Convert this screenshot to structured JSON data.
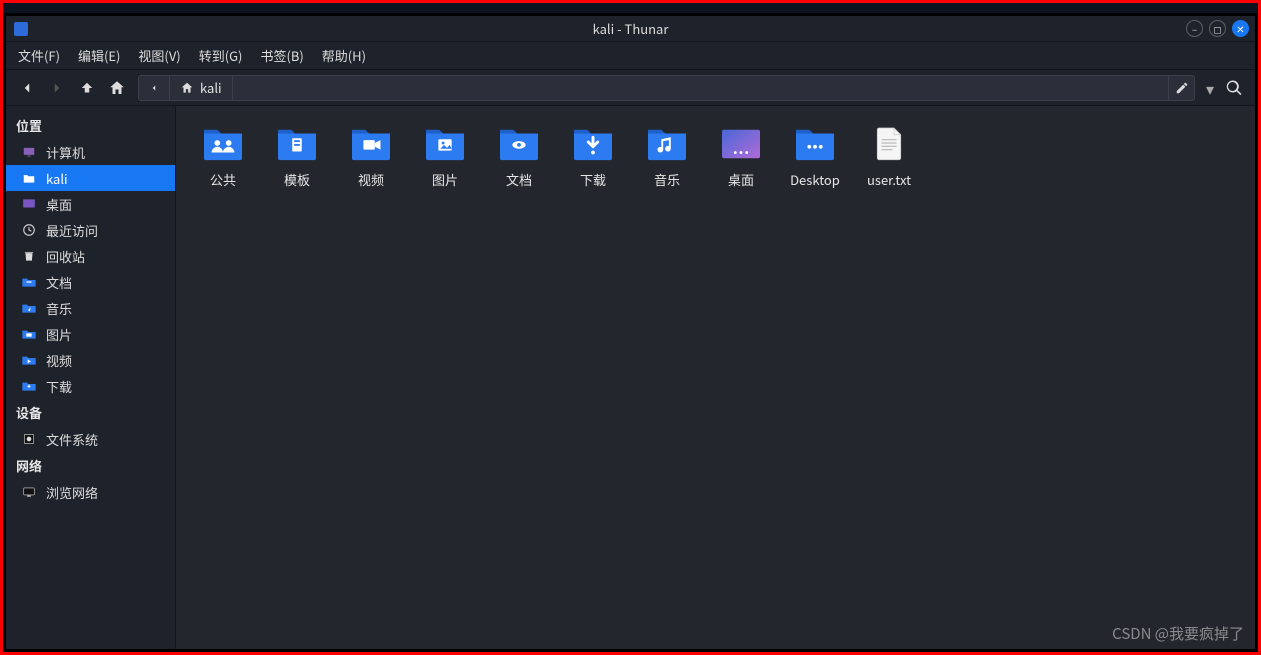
{
  "window_title": "kali - Thunar",
  "menubar": [
    "文件(F)",
    "编辑(E)",
    "视图(V)",
    "转到(G)",
    "书签(B)",
    "帮助(H)"
  ],
  "path": {
    "current": "kali"
  },
  "sidebar": {
    "sections": [
      {
        "header": "位置",
        "items": [
          {
            "icon": "computer",
            "label": "计算机"
          },
          {
            "icon": "home-folder",
            "label": "kali",
            "selected": true
          },
          {
            "icon": "desktop",
            "label": "桌面"
          },
          {
            "icon": "recent",
            "label": "最近访问"
          },
          {
            "icon": "trash",
            "label": "回收站"
          },
          {
            "icon": "documents",
            "label": "文档"
          },
          {
            "icon": "music",
            "label": "音乐"
          },
          {
            "icon": "pictures",
            "label": "图片"
          },
          {
            "icon": "videos",
            "label": "视频"
          },
          {
            "icon": "downloads",
            "label": "下载"
          }
        ]
      },
      {
        "header": "设备",
        "items": [
          {
            "icon": "filesystem",
            "label": "文件系统"
          }
        ]
      },
      {
        "header": "网络",
        "items": [
          {
            "icon": "network",
            "label": "浏览网络"
          }
        ]
      }
    ]
  },
  "files": [
    {
      "type": "folder",
      "glyph": "public",
      "label": "公共"
    },
    {
      "type": "folder",
      "glyph": "templates",
      "label": "模板"
    },
    {
      "type": "folder",
      "glyph": "videos",
      "label": "视频"
    },
    {
      "type": "folder",
      "glyph": "pictures",
      "label": "图片"
    },
    {
      "type": "folder",
      "glyph": "documents",
      "label": "文档"
    },
    {
      "type": "folder",
      "glyph": "downloads",
      "label": "下载"
    },
    {
      "type": "folder",
      "glyph": "music",
      "label": "音乐"
    },
    {
      "type": "desktop",
      "glyph": "desktop",
      "label": "桌面"
    },
    {
      "type": "folder",
      "glyph": "plain",
      "label": "Desktop"
    },
    {
      "type": "textfile",
      "glyph": "text",
      "label": "user.txt"
    }
  ],
  "watermark": "CSDN @我要疯掉了"
}
